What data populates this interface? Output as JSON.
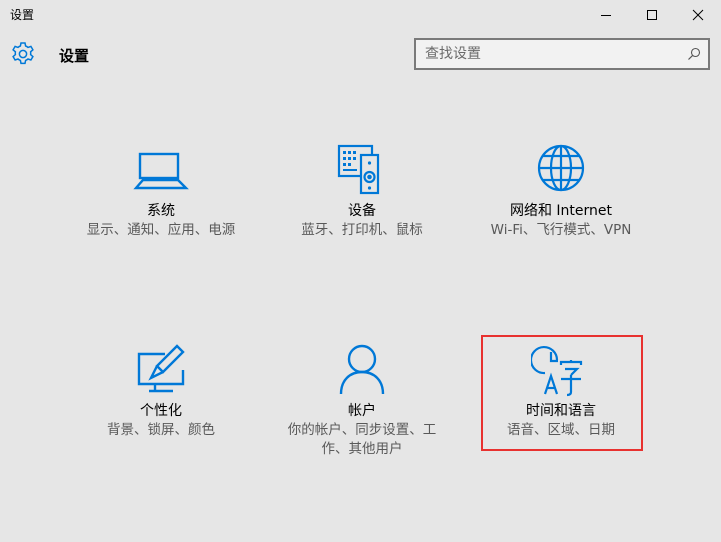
{
  "window": {
    "title": "设置"
  },
  "header": {
    "title": "设置"
  },
  "search": {
    "placeholder": "查找设置"
  },
  "colors": {
    "accent": "#0078d7",
    "highlight_border": "#e8312f",
    "background": "#e6e6e6"
  },
  "tiles": [
    {
      "icon": "laptop-icon",
      "name": "系统",
      "desc": "显示、通知、应用、电源"
    },
    {
      "icon": "devices-icon",
      "name": "设备",
      "desc": "蓝牙、打印机、鼠标"
    },
    {
      "icon": "globe-icon",
      "name": "网络和 Internet",
      "desc": "Wi-Fi、飞行模式、VPN"
    },
    {
      "icon": "personalization-icon",
      "name": "个性化",
      "desc": "背景、锁屏、颜色"
    },
    {
      "icon": "account-icon",
      "name": "帐户",
      "desc": "你的帐户、同步设置、工作、其他用户"
    },
    {
      "icon": "time-language-icon",
      "name": "时间和语言",
      "desc": "语音、区域、日期"
    }
  ]
}
